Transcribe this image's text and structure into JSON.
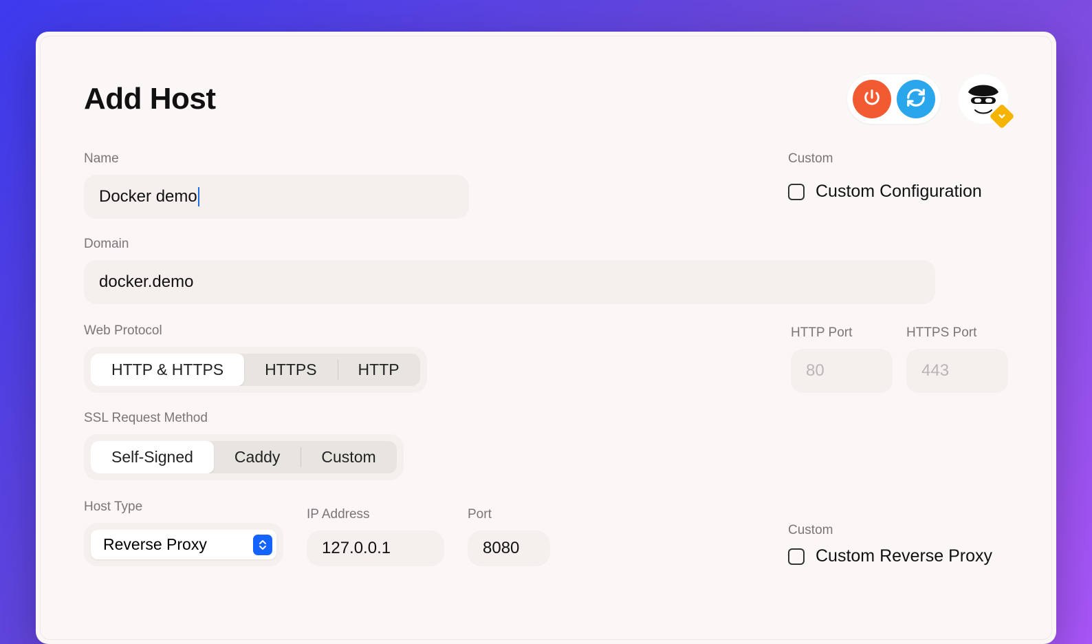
{
  "header": {
    "title": "Add Host"
  },
  "toolbar": {
    "power_icon": "power-icon",
    "refresh_icon": "refresh-icon"
  },
  "fields": {
    "name_label": "Name",
    "name_value": "Docker demo",
    "domain_label": "Domain",
    "domain_value": "docker.demo",
    "web_protocol_label": "Web Protocol",
    "ssl_method_label": "SSL Request Method",
    "host_type_label": "Host Type",
    "ip_label": "IP Address",
    "ip_value": "127.0.0.1",
    "port_label": "Port",
    "port_value": "8080",
    "http_port_label": "HTTP Port",
    "http_port_placeholder": "80",
    "https_port_label": "HTTPS Port",
    "https_port_placeholder": "443"
  },
  "segments": {
    "web_protocol": {
      "options": [
        "HTTP & HTTPS",
        "HTTPS",
        "HTTP"
      ],
      "selected": 0
    },
    "ssl_method": {
      "options": [
        "Self-Signed",
        "Caddy",
        "Custom"
      ],
      "selected": 0
    }
  },
  "host_type": {
    "selected": "Reverse Proxy"
  },
  "right": {
    "custom_label_top": "Custom",
    "custom_config_label": "Custom Configuration",
    "custom_label_bottom": "Custom",
    "custom_reverse_proxy_label": "Custom Reverse Proxy"
  }
}
